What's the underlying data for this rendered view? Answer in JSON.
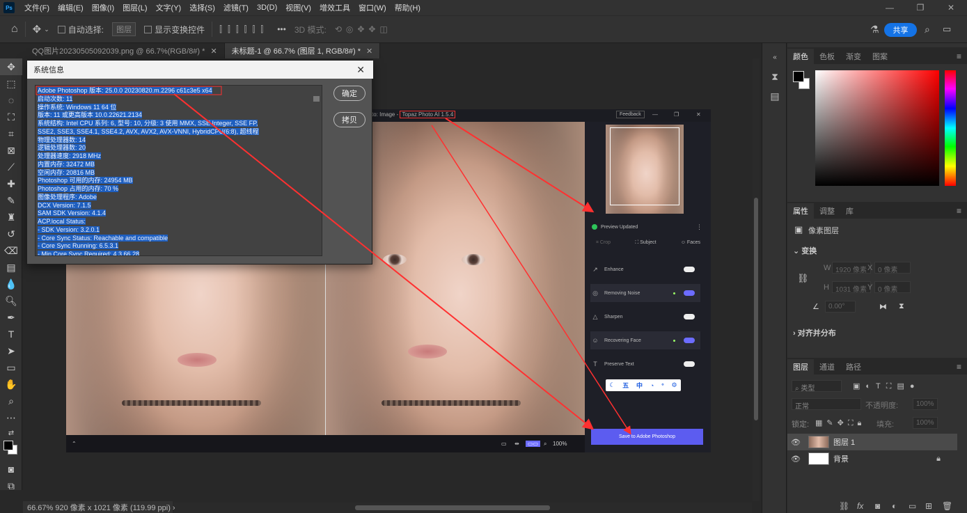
{
  "menubar": {
    "logo": "Ps",
    "items": [
      "文件(F)",
      "编辑(E)",
      "图像(I)",
      "图层(L)",
      "文字(Y)",
      "选择(S)",
      "滤镜(T)",
      "3D(D)",
      "视图(V)",
      "增效工具",
      "窗口(W)",
      "帮助(H)"
    ],
    "win_min": "—",
    "win_max": "❐",
    "win_close": "✕"
  },
  "optbar": {
    "auto_select": "自动选择:",
    "layer_select": "图层",
    "show_transform": "显示变换控件",
    "mode_3d": "3D 模式:",
    "share": "共享",
    "more": "•••"
  },
  "tabs": [
    {
      "label": "QQ图片20230505092039.png @ 66.7%(RGB/8#) *",
      "close": "✕"
    },
    {
      "label": "未标题-1 @ 66.7% (图层 1, RGB/8#) *",
      "close": "✕"
    }
  ],
  "dialog": {
    "title": "系统信息",
    "close": "✕",
    "ok": "确定",
    "copy": "拷贝",
    "lines": [
      "Adobe Photoshop 版本: 25.0.0 20230820.m.2296 c61c3e5  x64",
      "启动次数: 11",
      "操作系统: Windows 11 64 位",
      "版本: 11 或更高版本 10.0.22621.2134",
      "系统结构: Intel CPU 系列: 6,  型号: 10,  分级: 3 使用 MMX,  SSE Integer,  SSE FP,",
      "SSE2,  SSE3,  SSE4.1,  SSE4.2, AVX, AVX2, AVX-VNNI, HybridCPU(6:8),  超线程",
      "物理处理器数: 14",
      "逻辑处理器数: 20",
      "处理器速度: 2918 MHz",
      "内置内存: 32472 MB",
      "空闲内存: 20816 MB",
      "Photoshop 可用的内存: 24954 MB",
      "Photoshop 占用的内存: 70 %",
      "图像处理程序: Adobe",
      "DCX Version: 7.1.5",
      "SAM SDK Version: 4.1.4",
      "ACP.local Status:",
      " - SDK Version: 3.2.0.1",
      " - Core Sync Status: Reachable and compatible",
      " - Core Sync Running: 6.5.3.1",
      " - Min Core Sync Required: 4.3.66.28"
    ]
  },
  "topaz": {
    "title_prefix": "to: Image - ",
    "title_highlight": "Topaz Photo AI 1.5.4",
    "feedback": "Feedback",
    "preview_updated": "Preview Updated",
    "crop": "Crop",
    "subject": "Subject",
    "faces": "Faces",
    "rows": [
      {
        "label": "Enhance",
        "icon": "↗",
        "on": false
      },
      {
        "label": "Removing Noise",
        "icon": "◎",
        "on": true
      },
      {
        "label": "Sharpen",
        "icon": "△",
        "on": false
      },
      {
        "label": "Recovering Face",
        "icon": "☺",
        "on": true
      },
      {
        "label": "Preserve Text",
        "icon": "T",
        "on": false
      }
    ],
    "save_button": "Save to Adobe Photoshop",
    "zoom": "100%",
    "ime": [
      "☾",
      "五",
      "中",
      "◔",
      "°",
      "⚙"
    ]
  },
  "panels": {
    "color_tabs": [
      "颜色",
      "色板",
      "渐变",
      "图案"
    ],
    "props_tabs": [
      "属性",
      "调整",
      "库"
    ],
    "pixel_layer": "像素图层",
    "transform": "变换",
    "w_label": "W",
    "w_value": "1920 像素",
    "h_label": "H",
    "h_value": "1031 像素",
    "x_label": "X",
    "x_value": "0 像素",
    "y_label": "Y",
    "y_value": "0 像素",
    "angle": "0.00°",
    "align": "对齐并分布",
    "layers_tabs": [
      "图层",
      "通道",
      "路径"
    ],
    "kind": "类型",
    "blend": "正常",
    "opacity_label": "不透明度:",
    "opacity_value": "100%",
    "lock_label": "锁定:",
    "fill_label": "填充:",
    "fill_value": "100%",
    "layers": [
      {
        "name": "图层 1",
        "selected": true
      },
      {
        "name": "背景",
        "selected": false,
        "locked": true
      }
    ]
  },
  "statusbar": {
    "text": "66.67%  920 像素 x 1021 像素 (119.99 ppi)  ›"
  },
  "colors": {
    "accent": "#1473e6",
    "topaz_accent": "#5c5cf0",
    "selection": "#1f5fbf",
    "arrow": "#ff3030"
  }
}
